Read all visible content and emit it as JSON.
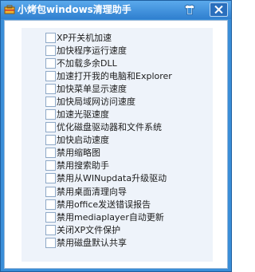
{
  "window": {
    "title": "小烤包windows清理助手",
    "colors": {
      "titlebar": "#3a8ed8",
      "accent": "#2f7fcf",
      "panel": "#eef3fa"
    },
    "icons": {
      "app": "toolbox-icon",
      "skin": "shirt-icon",
      "close": "close-icon"
    }
  },
  "options": [
    {
      "label": "XP开关机加速",
      "checked": false
    },
    {
      "label": "加快程序运行速度",
      "checked": false
    },
    {
      "label": "不加载多余DLL",
      "checked": false
    },
    {
      "label": "加速打开我的电脑和Explorer",
      "checked": false
    },
    {
      "label": "加快菜单显示速度",
      "checked": false
    },
    {
      "label": "加快局域网访问速度",
      "checked": false
    },
    {
      "label": "加速光驱速度",
      "checked": false
    },
    {
      "label": "优化磁盘驱动器和文件系统",
      "checked": false
    },
    {
      "label": "加快启动速度",
      "checked": false
    },
    {
      "label": "禁用缩略图",
      "checked": false
    },
    {
      "label": "禁用搜索助手",
      "checked": false
    },
    {
      "label": "禁用从WINupdata升级驱动",
      "checked": false
    },
    {
      "label": "禁用桌面清理向导",
      "checked": false
    },
    {
      "label": "禁用office发送错误报告",
      "checked": false
    },
    {
      "label": "禁用mediaplayer自动更新",
      "checked": false
    },
    {
      "label": "关闭XP文件保护",
      "checked": false
    },
    {
      "label": "禁用磁盘默认共享",
      "checked": false
    }
  ]
}
